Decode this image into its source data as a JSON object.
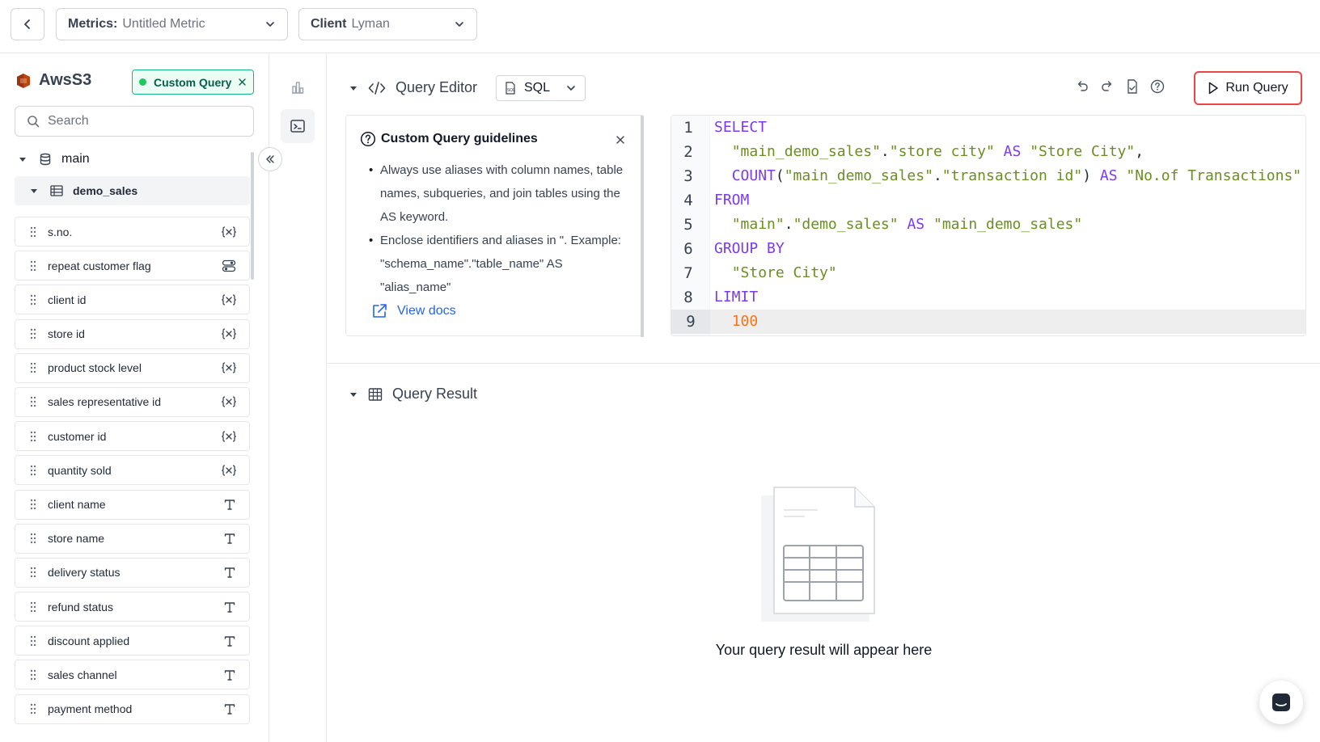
{
  "topbar": {
    "metrics_label": "Metrics:",
    "metrics_value": "Untitled Metric",
    "client_label": "Client",
    "client_value": "Lyman"
  },
  "datasource": {
    "name": "AwsS3",
    "badge": "Custom Query",
    "search_placeholder": "Search",
    "schema": "main",
    "table": "demo_sales",
    "columns": [
      {
        "name": "s.no.",
        "type_icon": "variable-icon"
      },
      {
        "name": "repeat customer flag",
        "type_icon": "toggle-icon"
      },
      {
        "name": "client id",
        "type_icon": "variable-icon"
      },
      {
        "name": "store id",
        "type_icon": "variable-icon"
      },
      {
        "name": "product stock level",
        "type_icon": "variable-icon"
      },
      {
        "name": "sales representative id",
        "type_icon": "variable-icon"
      },
      {
        "name": "customer id",
        "type_icon": "variable-icon"
      },
      {
        "name": "quantity sold",
        "type_icon": "variable-icon"
      },
      {
        "name": "client name",
        "type_icon": "text-icon"
      },
      {
        "name": "store name",
        "type_icon": "text-icon"
      },
      {
        "name": "delivery status",
        "type_icon": "text-icon"
      },
      {
        "name": "refund status",
        "type_icon": "text-icon"
      },
      {
        "name": "discount applied",
        "type_icon": "text-icon"
      },
      {
        "name": "sales channel",
        "type_icon": "text-icon"
      },
      {
        "name": "payment method",
        "type_icon": "text-icon"
      }
    ]
  },
  "editor": {
    "title": "Query Editor",
    "language": "SQL",
    "run_label": "Run Query",
    "guidelines": {
      "title": "Custom Query guidelines",
      "items": [
        "Always use aliases with column names, table names, subqueries, and join tables using the AS keyword.",
        "Enclose identifiers and aliases in \". Example: \"schema_name\".\"table_name\" AS \"alias_name\""
      ],
      "link": "View docs"
    },
    "code_lines": [
      "SELECT",
      "  \"main_demo_sales\".\"store city\" AS \"Store City\",",
      "  COUNT(\"main_demo_sales\".\"transaction id\") AS \"No.of Transactions\"",
      "FROM",
      "  \"main\".\"demo_sales\" AS \"main_demo_sales\"",
      "GROUP BY",
      "  \"Store City\"",
      "LIMIT",
      "  100"
    ]
  },
  "result": {
    "title": "Query Result",
    "empty_text": "Your query result will appear here"
  },
  "colors": {
    "accent_green": "#10b981",
    "run_border": "#ef4444",
    "link_blue": "#2563eb"
  }
}
